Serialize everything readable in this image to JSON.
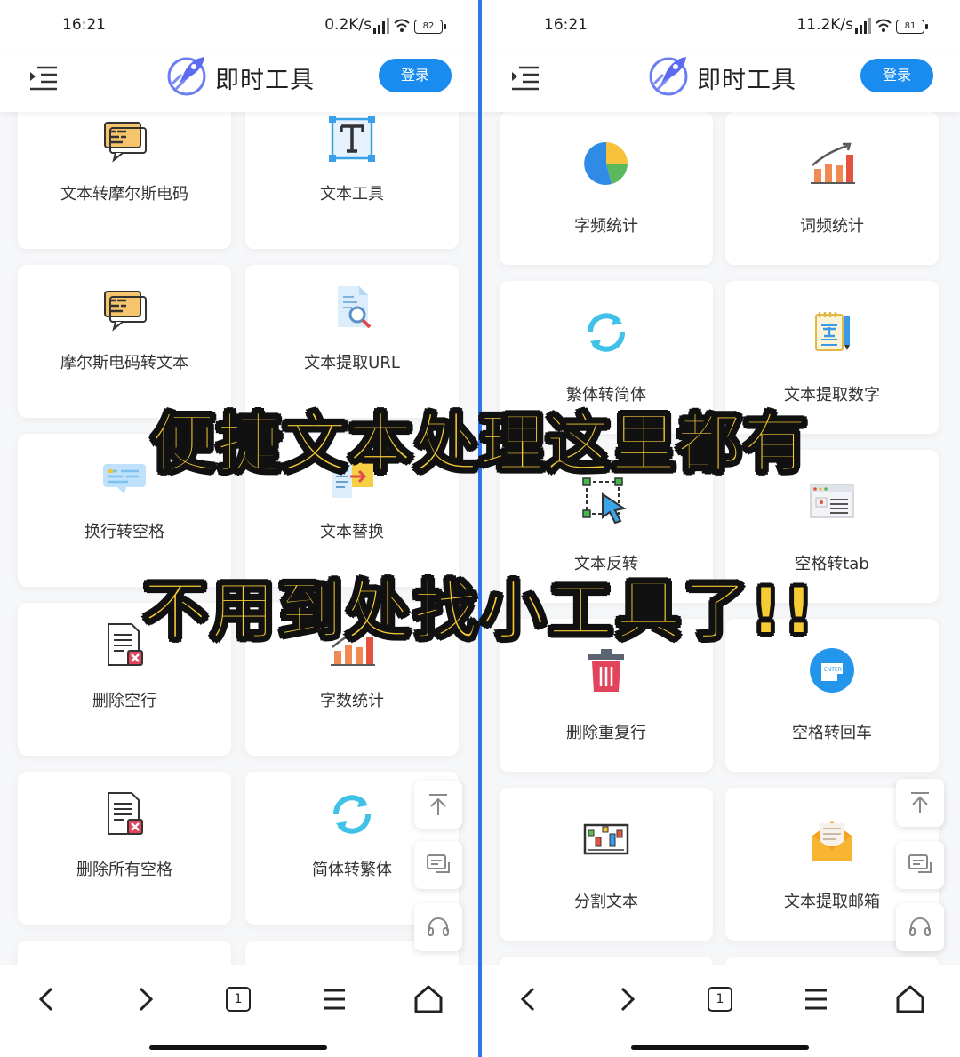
{
  "overlay": {
    "line1": "便捷文本处理这里都有",
    "line2": "不用到处找小工具了!!"
  },
  "left": {
    "status": {
      "time": "16:21",
      "speed": "0.2K/s",
      "battery": "82"
    },
    "app": {
      "title": "即时工具",
      "login": "登录"
    },
    "tools": [
      {
        "label": "文本转摩尔斯电码",
        "icon": "morse-chat-icon"
      },
      {
        "label": "文本工具",
        "icon": "text-t-icon"
      },
      {
        "label": "摩尔斯电码转文本",
        "icon": "morse-chat-icon"
      },
      {
        "label": "文本提取URL",
        "icon": "doc-search-icon"
      },
      {
        "label": "换行转空格",
        "icon": "chat-bubble-icon"
      },
      {
        "label": "文本替换",
        "icon": "doc-replace-icon"
      },
      {
        "label": "删除空行",
        "icon": "doc-delete-icon"
      },
      {
        "label": "字数统计",
        "icon": "bar-chart-icon"
      },
      {
        "label": "删除所有空格",
        "icon": "doc-delete-icon"
      },
      {
        "label": "简体转繁体",
        "icon": "refresh-icon"
      }
    ]
  },
  "right": {
    "status": {
      "time": "16:21",
      "speed": "11.2K/s",
      "battery": "81"
    },
    "app": {
      "title": "即时工具",
      "login": "登录"
    },
    "tools": [
      {
        "label": "字频统计",
        "icon": "pie-chart-icon"
      },
      {
        "label": "词频统计",
        "icon": "bar-chart-icon"
      },
      {
        "label": "繁体转简体",
        "icon": "refresh-icon"
      },
      {
        "label": "文本提取数字",
        "icon": "notepad-icon"
      },
      {
        "label": "文本反转",
        "icon": "cursor-select-icon"
      },
      {
        "label": "空格转tab",
        "icon": "browser-window-icon"
      },
      {
        "label": "删除重复行",
        "icon": "trash-icon"
      },
      {
        "label": "空格转回车",
        "icon": "enter-key-icon"
      },
      {
        "label": "分割文本",
        "icon": "split-board-icon"
      },
      {
        "label": "文本提取邮箱",
        "icon": "mail-icon"
      }
    ]
  },
  "nav": {
    "tab_count": "1"
  },
  "colors": {
    "accent": "#1a8cf0",
    "overlay_text": "#f6cb34",
    "divider": "#2f74ea"
  }
}
